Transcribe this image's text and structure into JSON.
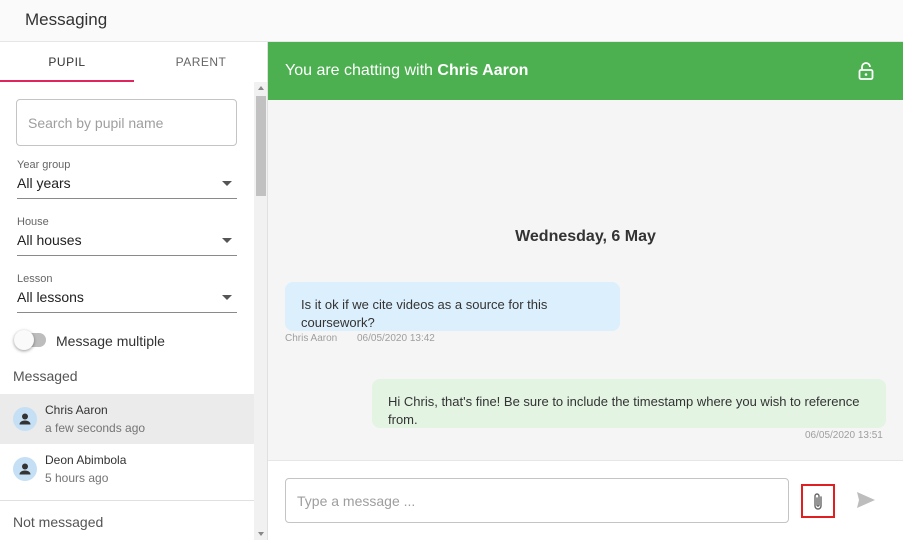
{
  "app": {
    "title": "Messaging"
  },
  "tabs": [
    {
      "label": "PUPIL",
      "active": true
    },
    {
      "label": "PARENT",
      "active": false
    }
  ],
  "search": {
    "placeholder": "Search by pupil name",
    "value": ""
  },
  "filters": [
    {
      "label": "Year group",
      "value": "All years"
    },
    {
      "label": "House",
      "value": "All houses"
    },
    {
      "label": "Lesson",
      "value": "All lessons"
    }
  ],
  "toggle": {
    "label": "Message multiple",
    "on": false
  },
  "sections": {
    "messaged": "Messaged",
    "not_messaged": "Not messaged"
  },
  "contacts": [
    {
      "name": "Chris Aaron",
      "time": "a few seconds ago",
      "active": true
    },
    {
      "name": "Deon Abimbola",
      "time": "5 hours ago",
      "active": false
    }
  ],
  "chat": {
    "header_prefix": "You are chatting with",
    "header_name": "Chris Aaron",
    "date": "Wednesday, 6 May",
    "messages": [
      {
        "direction": "incoming",
        "text": "Is it ok if we cite videos as a source for this coursework?",
        "sender": "Chris Aaron",
        "timestamp": "06/05/2020 13:42"
      },
      {
        "direction": "outgoing",
        "text": "Hi Chris, that's fine! Be sure to include the timestamp where you wish to reference from.",
        "timestamp": "06/05/2020 13:51"
      }
    ],
    "composer_placeholder": "Type a message ..."
  },
  "colors": {
    "header_green": "#4caf50",
    "tab_indicator": "#e0245e",
    "incoming_bubble": "#dceffc",
    "outgoing_bubble": "#e3f4e3",
    "highlight_box": "#e02020"
  },
  "icons": {
    "lock": "lock-open-icon",
    "attach": "paperclip-icon",
    "send": "send-icon",
    "avatar": "person-icon"
  }
}
